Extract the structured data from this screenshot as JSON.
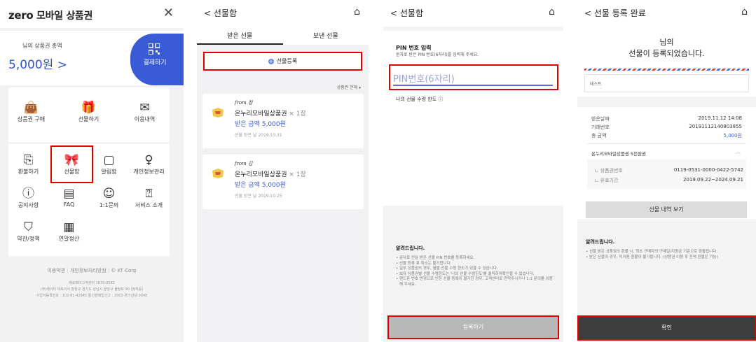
{
  "screen1": {
    "logo": "zero",
    "title": "모바일 상품권",
    "close": "✕",
    "balance_label": "님의 상품권 총액",
    "balance_amount": "5,000원 >",
    "pay_label": "결제하기",
    "quick_menu": [
      {
        "label": "상품권 구매",
        "icon": "bag-icon"
      },
      {
        "label": "선물하기",
        "icon": "gift-hand-icon"
      },
      {
        "label": "이용내역",
        "icon": "envelope-icon"
      }
    ],
    "menu": [
      {
        "label": "환불하기",
        "icon": "refund-icon"
      },
      {
        "label": "선물함",
        "icon": "gift-box-icon"
      },
      {
        "label": "알림함",
        "icon": "notification-icon"
      },
      {
        "label": "개인정보관리",
        "icon": "person-settings-icon"
      },
      {
        "label": "공지사항",
        "icon": "notice-icon"
      },
      {
        "label": "FAQ",
        "icon": "faq-icon"
      },
      {
        "label": "1:1문의",
        "icon": "chat-icon"
      },
      {
        "label": "서비스 소개",
        "icon": "question-icon"
      },
      {
        "label": "약관/정책",
        "icon": "shield-check-icon"
      },
      {
        "label": "연말정산",
        "icon": "calculator-icon"
      }
    ],
    "footer_links": [
      "이용약관",
      "개인정보처리방침",
      "© KT Corp"
    ],
    "footer_info": [
      "제로페이고객센터 1670-0582",
      "(주)케이티 대표이사 황창규 경기도 성남시 분당구 불정로 90 (정자동)",
      "사업자등록번호 : 102-81-42945 통신판매업신고 : 2002-경기성남-0048"
    ]
  },
  "screen2": {
    "back": "< 선물함",
    "tabs": [
      "받은 선물",
      "보낸 선물"
    ],
    "register": "선물등록",
    "filter": "상품권 전체 ▾",
    "gifts": [
      {
        "from": "from 정",
        "product": "온누리모바일상품권",
        "qty": "× 1장",
        "amount": "받은 금액 5,000원",
        "date": "선물 받은 날 2019.10.31"
      },
      {
        "from": "from 김",
        "product": "온누리모바일상품권",
        "qty": "× 1장",
        "amount": "받은 금액 5,000원",
        "date": "선물 받은 날 2019.10.25"
      }
    ]
  },
  "screen3": {
    "back": "< 선물함",
    "pin_title": "PIN 번호 입력",
    "pin_sub": "문자로 받은 PIN 번호(6자리)를 입력해 주세요.",
    "pin_placeholder": "PIN번호(6자리)",
    "limit": "나의 선물 수령 한도 ⓘ",
    "notice_title": "알려드립니다.",
    "notices": [
      "문자로 전달 받은 선물 PIN 번호를 등록하세요.",
      "선물 등록 후 취소는 불가합니다.",
      "일부 상품권의 경우, 월별 선물 수령 한도가 있을 수 있습니다.",
      "보유 상품권별 선물 수령한도는 '나의 선물 수령한도'를 클릭하여확인할 수 있습니다.",
      "핸드폰 번호 변경으로 인한 선물 등록이 불가한 경우, 고객센터로 연락주시거나 1:1 문의를 이용해 주세요."
    ],
    "submit": "등록하기"
  },
  "screen4": {
    "back": "< 선물 등록 완료",
    "name_line": "님의",
    "headline": "선물이 등록되었습니다.",
    "memo": "테스트",
    "details": [
      {
        "k": "받은날짜",
        "v": "2019.11.12 14:08"
      },
      {
        "k": "거래번호",
        "v": "20191112140803855"
      },
      {
        "k": "총 금액",
        "v": "5,000원"
      }
    ],
    "product_name": "온누리모바일상품권 5천원권",
    "sub_details": [
      {
        "k": "ㄴ 상품권번호",
        "v": "0119-0531-0000-0422-5742"
      },
      {
        "k": "ㄴ 유효기간",
        "v": "2019.09.22~2024.09.21"
      }
    ],
    "view_button": "선물 내역 보기",
    "notice_title": "알려드립니다.",
    "notices": [
      "선물 받은 상품권의 환불 시, 최초 구매자의 구매일/지원금 기준으로 환불됩니다.",
      "받은 선물의 경우, 미이용 환불이 불가합니다. (상품권 이용 후 잔액 환불은 가능)"
    ],
    "confirm": "확인"
  },
  "colors": {
    "brand_blue": "#3a5bd6",
    "highlight_red": "#e00000",
    "confirm_dark": "#3d3d3d"
  }
}
